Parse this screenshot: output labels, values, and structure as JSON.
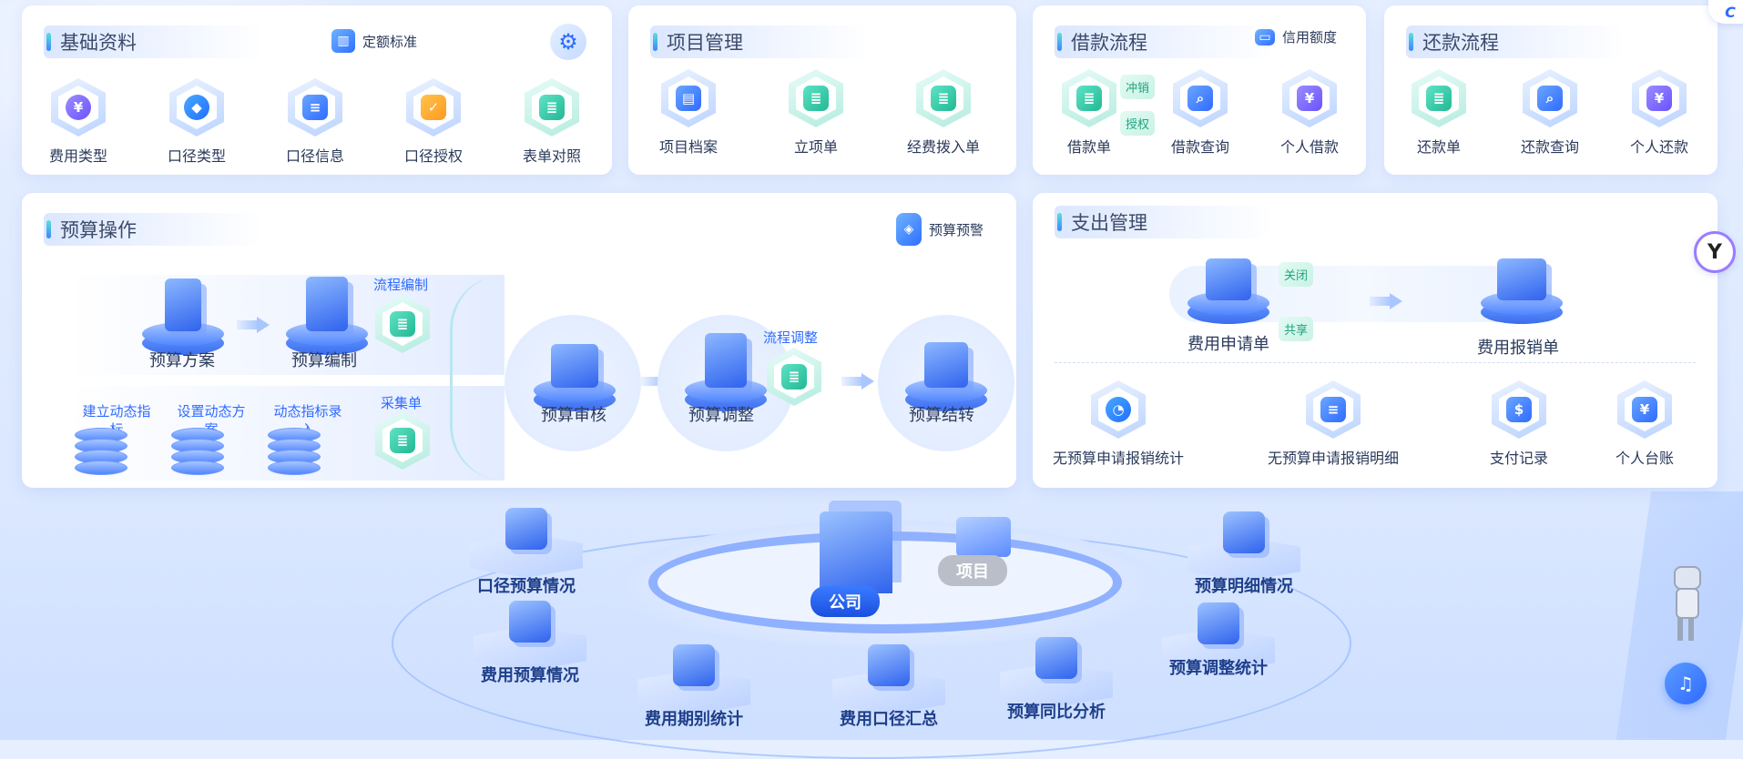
{
  "basics": {
    "title": "基础资料",
    "tag": "定额标准",
    "items": [
      {
        "label": "费用类型",
        "icon": "yuan-icon"
      },
      {
        "label": "口径类型",
        "icon": "cube-icon"
      },
      {
        "label": "口径信息",
        "icon": "document-icon"
      },
      {
        "label": "口径授权",
        "icon": "shield-check-icon"
      },
      {
        "label": "表单对照",
        "icon": "form-icon"
      }
    ]
  },
  "project": {
    "title": "项目管理",
    "items": [
      {
        "label": "项目档案",
        "icon": "folder-icon"
      },
      {
        "label": "立项单",
        "icon": "form-icon"
      },
      {
        "label": "经费拨入单",
        "icon": "form-icon"
      }
    ]
  },
  "borrow": {
    "title": "借款流程",
    "tag": "信用额度",
    "chips": [
      "冲销",
      "授权"
    ],
    "items": [
      {
        "label": "借款单",
        "icon": "form-icon"
      },
      {
        "label": "借款查询",
        "icon": "search-doc-icon"
      },
      {
        "label": "个人借款",
        "icon": "personal-yuan-icon"
      }
    ]
  },
  "repay": {
    "title": "还款流程",
    "items": [
      {
        "label": "还款单",
        "icon": "form-icon"
      },
      {
        "label": "还款查询",
        "icon": "search-doc-icon"
      },
      {
        "label": "个人还款",
        "icon": "personal-yuan-icon"
      }
    ]
  },
  "budget": {
    "title": "预算操作",
    "tag": "预算预警",
    "plan": "预算方案",
    "compile": "预算编制",
    "flow_compile": "流程编制",
    "dyn": [
      "建立动态指标",
      "设置动态方案",
      "动态指标录入"
    ],
    "collect": "采集单",
    "review": "预算审核",
    "adjust": "预算调整",
    "flow_adjust": "流程调整",
    "carry": "预算结转"
  },
  "expense": {
    "title": "支出管理",
    "apply": "费用申请单",
    "reimburse": "费用报销单",
    "close": "关闭",
    "share": "共享",
    "items": [
      {
        "label": "无预算申请报销统计",
        "icon": "pie-icon"
      },
      {
        "label": "无预算申请报销明细",
        "icon": "document-icon"
      },
      {
        "label": "支付记录",
        "icon": "payment-icon"
      },
      {
        "label": "个人台账",
        "icon": "ledger-icon"
      }
    ]
  },
  "hub": {
    "company": "公司",
    "project": "项目",
    "platforms": [
      "口径预算情况",
      "预算明细情况",
      "费用预算情况",
      "预算调整统计",
      "费用期别统计",
      "费用口径汇总",
      "预算同比分析"
    ]
  },
  "colors": {
    "accent": "#2f6bff",
    "green": "#22b894"
  }
}
